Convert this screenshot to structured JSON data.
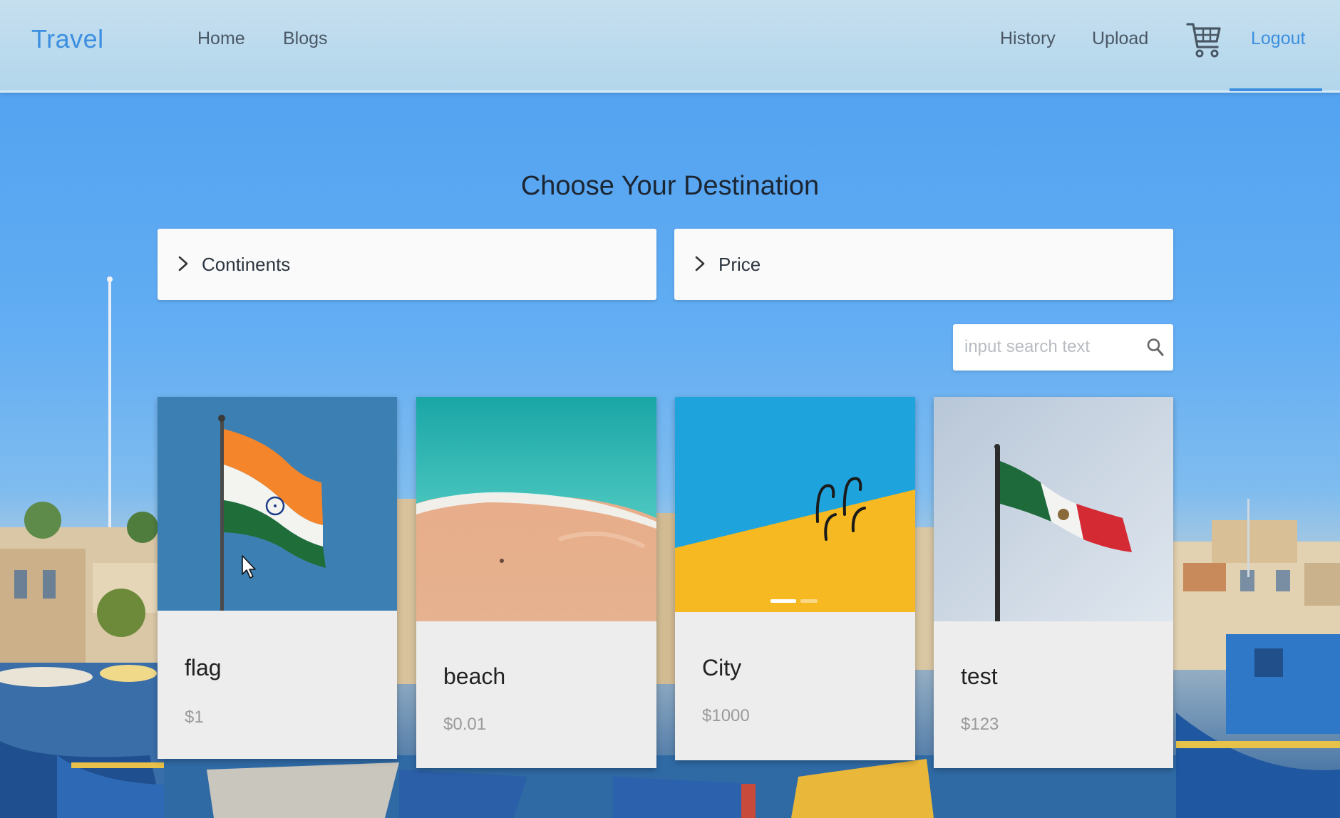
{
  "header": {
    "logo": "Travel",
    "nav_left": [
      {
        "label": "Home"
      },
      {
        "label": "Blogs"
      }
    ],
    "nav_right": [
      {
        "label": "History"
      },
      {
        "label": "Upload"
      },
      {
        "label": "Logout",
        "active": true
      }
    ],
    "cart_icon": "shopping-cart-icon"
  },
  "main": {
    "title": "Choose Your Destination",
    "filters": [
      {
        "label": "Continents",
        "icon": "chevron-right-icon",
        "expanded": false
      },
      {
        "label": "Price",
        "icon": "chevron-right-icon",
        "expanded": false
      }
    ],
    "search": {
      "placeholder": "input search text",
      "value": "",
      "icon": "search-icon"
    },
    "cards": [
      {
        "title": "flag",
        "price": "$1",
        "image": "india-flag"
      },
      {
        "title": "beach",
        "price": "$0.01",
        "image": "aerial-beach"
      },
      {
        "title": "City",
        "price": "$1000",
        "image": "yellow-wall-pool-ladder",
        "carousel_dots": 2,
        "carousel_active": 1
      },
      {
        "title": "test",
        "price": "$123",
        "image": "mexico-flag"
      }
    ]
  },
  "colors": {
    "accent": "#3c8fe0",
    "header_bg": "#bcdbee",
    "sky": "#5aa7ee",
    "card_bg": "#ededed"
  }
}
